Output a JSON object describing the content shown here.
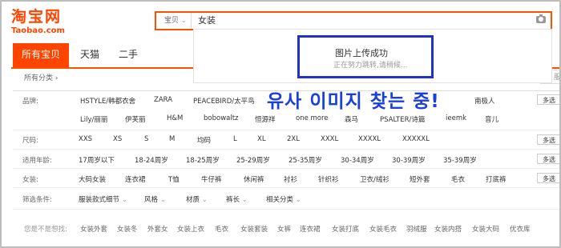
{
  "logo": {
    "cn": "淘宝网",
    "en": "Taobao.com"
  },
  "search": {
    "scope": "宝贝",
    "query": "女装"
  },
  "popup": {
    "title": "图片上传成功",
    "subtitle": "正在努力跳转,请稍候..."
  },
  "overlay_text": "유사 이미지 찾는 중!",
  "tabs": [
    "所有宝贝",
    "天猫",
    "二手"
  ],
  "breadcrumb": "所有分类 ›",
  "filters": {
    "brand": {
      "label": "品牌:",
      "row1": [
        "HSTYLE/韩都衣舍",
        "ZARA",
        "PEACEBIRD/太平鸟",
        "",
        "",
        "",
        "",
        "南极人"
      ],
      "row2": [
        "Lily/丽丽",
        "伊芙丽",
        "H&M",
        "bobowaltz",
        "恒源祥",
        "one more",
        "森马",
        "PSALTER/诗篇",
        "ieemk",
        "音儿"
      ],
      "more": "多选"
    },
    "size": {
      "label": "尺码:",
      "values": [
        "XXS",
        "XS",
        "S",
        "M",
        "均码",
        "L",
        "XL",
        "2XL",
        "XXXL",
        "XXXXL",
        "XXXXXL"
      ],
      "more": "多选"
    },
    "age": {
      "label": "适用年龄:",
      "values": [
        "17周岁以下",
        "18-24周岁",
        "18-25周岁",
        "25-29周岁",
        "25-35周岁",
        "30-34周岁",
        "30-39周岁",
        "35-39周岁"
      ],
      "more": "多选"
    },
    "type": {
      "label": "女装:",
      "values": [
        "大码女装",
        "连衣裙",
        "T恤",
        "牛仔裤",
        "休闲裤",
        "衬衫",
        "针织衫",
        "卫衣/绒衫",
        "短外套",
        "毛衣",
        "打底裤"
      ],
      "more": "多选"
    },
    "conditions": {
      "label": "筛选条件:",
      "values": [
        "服装款式细节",
        "风格",
        "材质",
        "裤长",
        "相关分类"
      ]
    }
  },
  "suggestions": {
    "label": "您是不是想找:",
    "values": [
      "女装外套",
      "女装冬",
      "外套女",
      "女装上衣",
      "毛衣",
      "女装套装",
      "女裤",
      "连衣裙",
      "女装打底",
      "女装毛衣",
      "羽绒服",
      "女装内搭",
      "女装大码",
      "优衣库"
    ]
  }
}
